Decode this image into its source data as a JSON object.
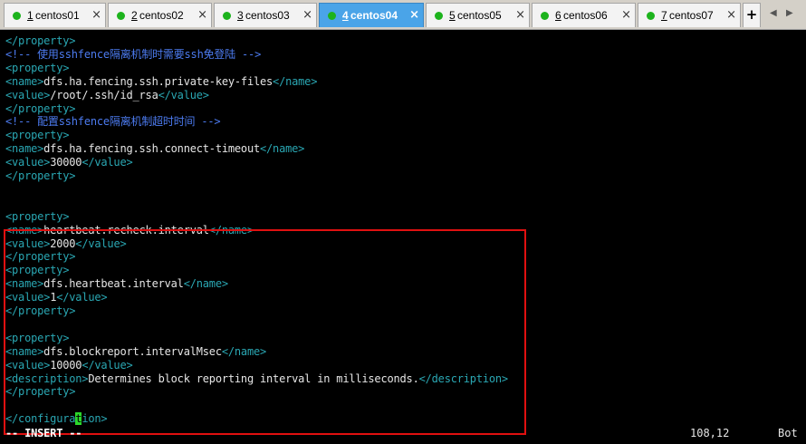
{
  "tabs": [
    {
      "num": "1",
      "name": " centos01",
      "active": false
    },
    {
      "num": "2",
      "name": " centos02",
      "active": false
    },
    {
      "num": "3",
      "name": " centos03",
      "active": false
    },
    {
      "num": "4",
      "name": " centos04",
      "active": true
    },
    {
      "num": "5",
      "name": " centos05",
      "active": false
    },
    {
      "num": "6",
      "name": " centos06",
      "active": false
    },
    {
      "num": "7",
      "name": " centos07",
      "active": false
    }
  ],
  "add_tab_label": "+",
  "close_glyph": "×",
  "nav_left": "◀",
  "nav_right": "▶",
  "lines": [
    [
      [
        "tag",
        "</property>"
      ]
    ],
    [
      [
        "cmt",
        "<!-- 使用sshfence隔离机制时需要ssh免登陆 -->"
      ]
    ],
    [
      [
        "tag",
        "<property>"
      ]
    ],
    [
      [
        "tag",
        "<name>"
      ],
      [
        "txt",
        "dfs.ha.fencing.ssh.private-key-files"
      ],
      [
        "tag",
        "</name>"
      ]
    ],
    [
      [
        "tag",
        "<value>"
      ],
      [
        "txt",
        "/root/.ssh/id_rsa"
      ],
      [
        "tag",
        "</value>"
      ]
    ],
    [
      [
        "tag",
        "</property>"
      ]
    ],
    [
      [
        "cmt",
        "<!-- 配置sshfence隔离机制超时时间 -->"
      ]
    ],
    [
      [
        "tag",
        "<property>"
      ]
    ],
    [
      [
        "tag",
        "<name>"
      ],
      [
        "txt",
        "dfs.ha.fencing.ssh.connect-timeout"
      ],
      [
        "tag",
        "</name>"
      ]
    ],
    [
      [
        "tag",
        "<value>"
      ],
      [
        "txt",
        "30000"
      ],
      [
        "tag",
        "</value>"
      ]
    ],
    [
      [
        "tag",
        "</property>"
      ]
    ],
    [],
    [],
    [
      [
        "tag",
        "<property>"
      ]
    ],
    [
      [
        "tag",
        "<name>"
      ],
      [
        "txt",
        "heartbeat.recheck.interval"
      ],
      [
        "tag",
        "</name>"
      ]
    ],
    [
      [
        "tag",
        "<value>"
      ],
      [
        "txt",
        "2000"
      ],
      [
        "tag",
        "</value>"
      ]
    ],
    [
      [
        "tag",
        "</property>"
      ]
    ],
    [
      [
        "tag",
        "<property>"
      ]
    ],
    [
      [
        "tag",
        "<name>"
      ],
      [
        "txt",
        "dfs.heartbeat.interval"
      ],
      [
        "tag",
        "</name>"
      ]
    ],
    [
      [
        "tag",
        "<value>"
      ],
      [
        "txt",
        "1"
      ],
      [
        "tag",
        "</value>"
      ]
    ],
    [
      [
        "tag",
        "</property>"
      ]
    ],
    [],
    [
      [
        "tag",
        "<property>"
      ]
    ],
    [
      [
        "tag",
        "<name>"
      ],
      [
        "txt",
        "dfs.blockreport.intervalMsec"
      ],
      [
        "tag",
        "</name>"
      ]
    ],
    [
      [
        "tag",
        "<value>"
      ],
      [
        "txt",
        "10000"
      ],
      [
        "tag",
        "</value>"
      ]
    ],
    [
      [
        "tag",
        "<description>"
      ],
      [
        "txt",
        "Determines block reporting interval in milliseconds."
      ],
      [
        "tag",
        "</description>"
      ]
    ],
    [
      [
        "tag",
        "</property>"
      ]
    ],
    [],
    [
      [
        "tag",
        "</configura"
      ],
      [
        "cursor",
        "t"
      ],
      [
        "tag",
        "ion>"
      ]
    ]
  ],
  "status": {
    "mode": "-- INSERT --",
    "position": "108,12",
    "scroll": "Bot"
  },
  "colors": {
    "tag": "#2aa7b3",
    "comment": "#4c7bf0",
    "cursor": "#2bd82b",
    "highlight_border": "#e01010",
    "active_tab": "#4aa4e8"
  }
}
